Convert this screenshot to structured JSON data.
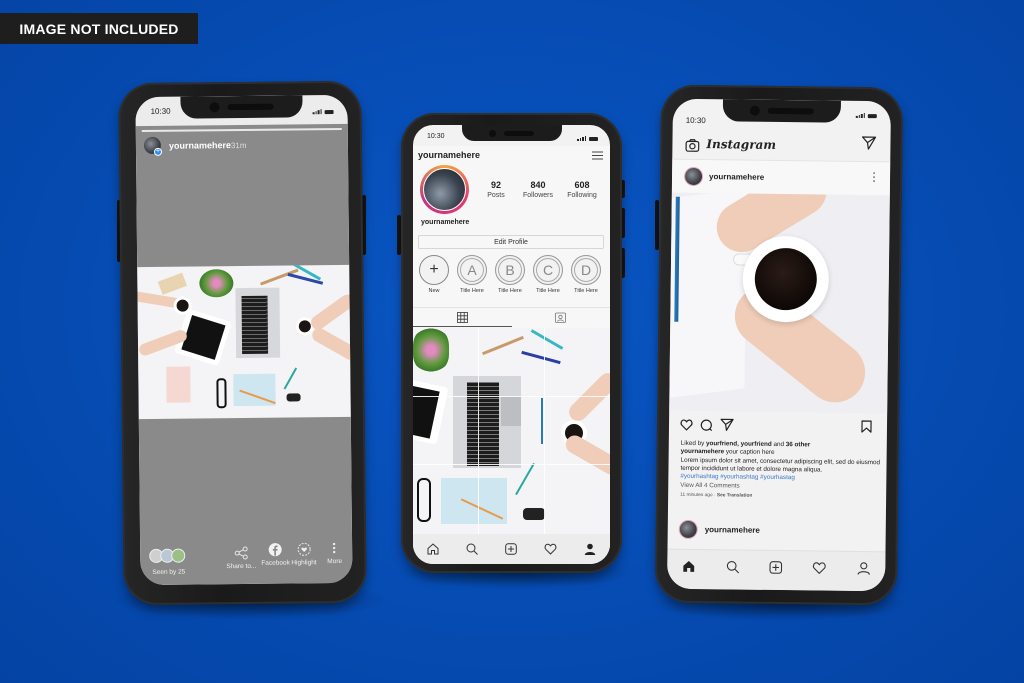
{
  "banner": {
    "text": "IMAGE NOT INCLUDED"
  },
  "colors": {
    "background": "#064cb3",
    "phone_body": "#1f1f1f",
    "hashtag": "#3a77c8",
    "story_bg": "#8a8a8a"
  },
  "phones": {
    "story": {
      "status_time": "10:30",
      "username": "yournamehere",
      "time_ago": "31m",
      "seen_by": "Seen by 25",
      "actions": [
        {
          "icon": "share-icon",
          "label": "Share to..."
        },
        {
          "icon": "facebook-icon",
          "label": "Facebook"
        },
        {
          "icon": "highlight-icon",
          "label": "Highlight"
        },
        {
          "icon": "more-icon",
          "label": "More"
        }
      ]
    },
    "profile": {
      "status_time": "10:30",
      "header_username": "yournamehere",
      "display_name": "yournamehere",
      "stats": [
        {
          "value": "92",
          "label": "Posts"
        },
        {
          "value": "840",
          "label": "Followers"
        },
        {
          "value": "608",
          "label": "Following"
        }
      ],
      "edit_profile_label": "Edit Profile",
      "highlights": [
        {
          "glyph": "+",
          "label": "New"
        },
        {
          "glyph": "A",
          "label": "Title Here"
        },
        {
          "glyph": "B",
          "label": "Title Here"
        },
        {
          "glyph": "C",
          "label": "Title Here"
        },
        {
          "glyph": "D",
          "label": "Title Here"
        }
      ],
      "tabs": [
        {
          "icon": "grid-icon"
        },
        {
          "icon": "tagged-icon"
        }
      ],
      "nav": [
        "home-icon",
        "search-icon",
        "add-post-icon",
        "heart-icon",
        "profile-filled-icon"
      ]
    },
    "feed": {
      "status_time": "10:30",
      "app_name": "Instagram",
      "post_username": "yournamehere",
      "liked_prefix": "Liked by ",
      "liked_friend1": "yourfriend",
      "liked_sep": ", ",
      "liked_friend2": "yourfriend",
      "liked_and": " and ",
      "liked_others": "36 other",
      "caption_user": "yournamehere",
      "caption_text": " your caption here",
      "body": "Lorem ipsum dolor sit amet, consectetur adipiscing elit, sed do eiusmod tempor incididunt ut labore et dolore magna aliqua.",
      "hashtags": "#yourhashtag #yourhashtag #yourhastag",
      "view_comments": "View All 4 Comments",
      "time_ago": "11 minutes ago",
      "see_translation": "See Translation",
      "next_post_username": "yournamehere",
      "nav": [
        "home-filled-icon",
        "search-icon",
        "add-post-icon",
        "heart-icon",
        "profile-outline-icon"
      ]
    }
  }
}
